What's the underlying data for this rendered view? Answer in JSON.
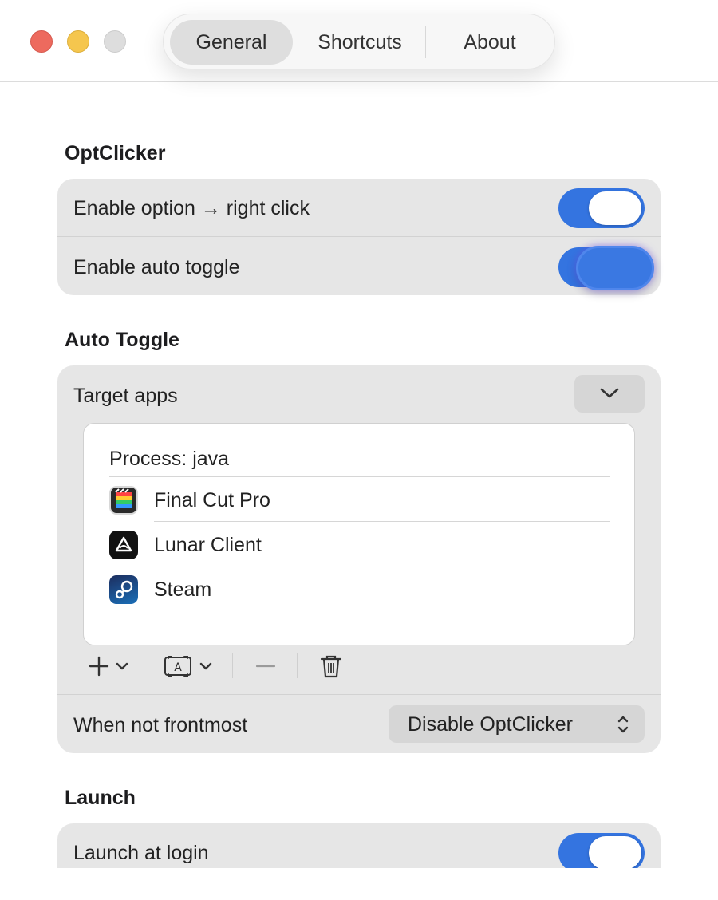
{
  "window": {
    "tabs": [
      {
        "label": "General",
        "active": true
      },
      {
        "label": "Shortcuts",
        "active": false
      },
      {
        "label": "About",
        "active": false
      }
    ]
  },
  "sections": {
    "optclicker": {
      "title": "OptClicker",
      "rows": [
        {
          "label": "Enable option → right click",
          "toggle_on": true
        },
        {
          "label": "Enable auto toggle",
          "toggle_on": true
        }
      ]
    },
    "auto_toggle": {
      "title": "Auto Toggle",
      "target_apps_label": "Target apps",
      "process_entry": "Process: java",
      "apps": [
        {
          "name": "Final Cut Pro",
          "icon": "final-cut-pro-icon"
        },
        {
          "name": "Lunar Client",
          "icon": "lunar-client-icon"
        },
        {
          "name": "Steam",
          "icon": "steam-icon"
        }
      ],
      "when_not_frontmost_label": "When not frontmost",
      "when_not_frontmost_value": "Disable OptClicker"
    },
    "launch": {
      "title": "Launch",
      "rows": [
        {
          "label": "Launch at login",
          "toggle_on": true
        }
      ]
    }
  },
  "colors": {
    "accent": "#3474e0",
    "group_background": "#e6e6e6"
  }
}
